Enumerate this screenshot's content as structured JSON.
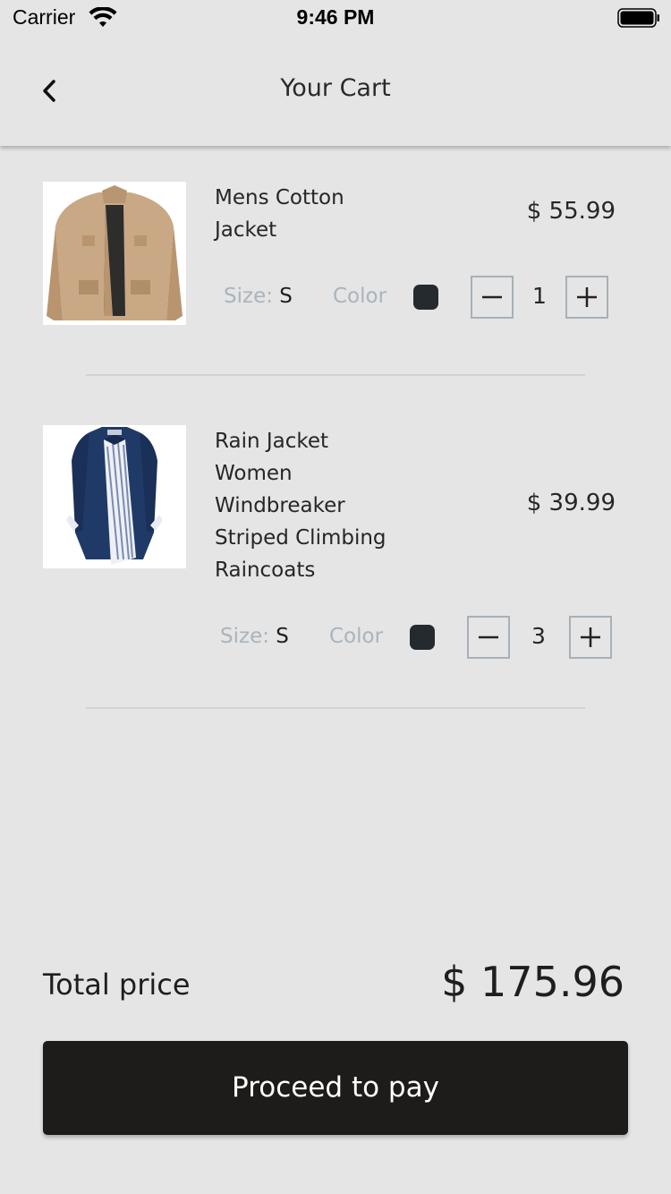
{
  "status_bar": {
    "carrier": "Carrier",
    "time": "9:46 PM"
  },
  "header": {
    "title": "Your Cart",
    "back_icon": "chevron-left-icon"
  },
  "cart": {
    "items": [
      {
        "name_lines": [
          "Mens Cotton",
          "Jacket"
        ],
        "price": "$ 55.99",
        "size_label": "Size: ",
        "size_value": "S",
        "color_label": "Color",
        "color": "#252a2e",
        "quantity": "1",
        "image_icon": "khaki-jacket-image"
      },
      {
        "name_lines": [
          "Rain Jacket",
          "Women",
          "Windbreaker",
          "Striped Climbing",
          "Raincoats"
        ],
        "price": "$ 39.99",
        "size_label": "Size: ",
        "size_value": "S",
        "color_label": "Color",
        "color": "#252a2e",
        "quantity": "3",
        "image_icon": "navy-raincoat-image"
      }
    ]
  },
  "summary": {
    "total_label": "Total price",
    "total_value": "$ 175.96"
  },
  "pay_button": {
    "label": "Proceed to pay"
  },
  "colors": {
    "background": "#e5e5e5",
    "button": "#1d1c1a",
    "muted_text": "#a9b4bd"
  }
}
